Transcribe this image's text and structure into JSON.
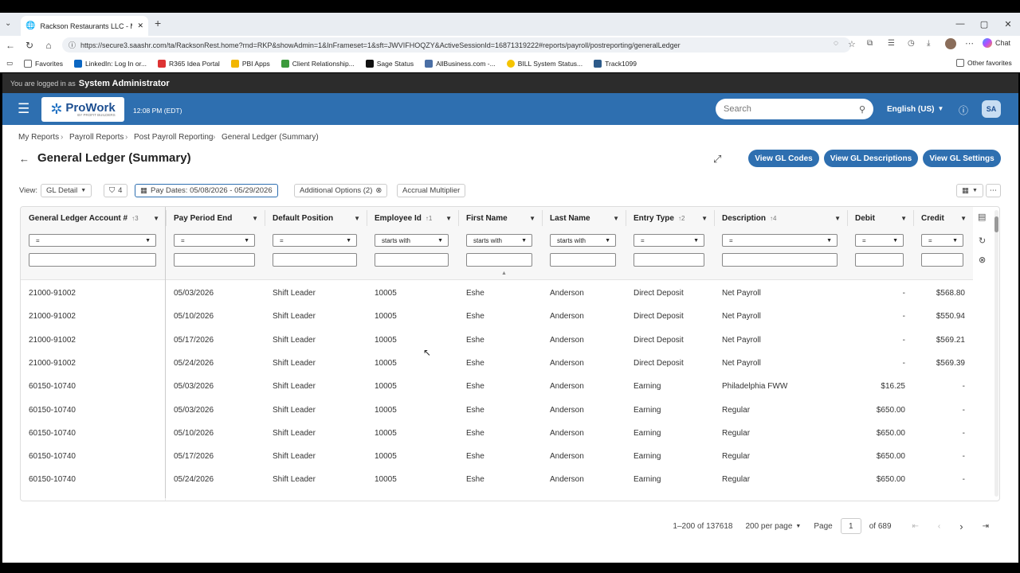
{
  "browser": {
    "tab_title": "Rackson Restaurants LLC - My Rep",
    "url": "https://secure3.saashr.com/ta/RacksonRest.home?rnd=RKP&showAdmin=1&InFrameset=1&sft=JWVIFHOQZY&ActiveSessionId=16871319222#reports/payroll/postreporting/generalLedger",
    "chat_label": "Chat",
    "bookmarks": [
      "Favorites",
      "LinkedIn: Log In or...",
      "R365 Idea Portal",
      "PBI Apps",
      "Client Relationship...",
      "Sage Status",
      "AllBusiness.com -...",
      "BILL System Status...",
      "Track1099"
    ],
    "other_favorites": "Other favorites"
  },
  "app": {
    "logged_in_prefix": "You are logged in as",
    "logged_in_user": "System Administrator",
    "logo_text": "ProWork",
    "logo_sub": "BY PROFIT BUILDERS",
    "time": "12:08 PM (EDT)",
    "search_placeholder": "Search",
    "language": "English (US)",
    "avatar_initials": "SA"
  },
  "breadcrumb": [
    "My Reports",
    "Payroll Reports",
    "Post Payroll Reporting",
    "General Ledger (Summary)"
  ],
  "page_title": "General Ledger (Summary)",
  "buttons": {
    "gl_codes": "View GL Codes",
    "gl_descriptions": "View GL Descriptions",
    "gl_settings": "View GL Settings"
  },
  "toolbar": {
    "view_label": "View:",
    "view_value": "GL Detail",
    "filter_count": "4",
    "pay_dates": "Pay Dates: 05/08/2026 - 05/29/2026",
    "additional_options": "Additional Options (2)",
    "accrual_multiplier": "Accrual Multiplier"
  },
  "columns": [
    {
      "label": "General Ledger Account #",
      "sort": "↑3",
      "filter": "="
    },
    {
      "label": "Pay Period End",
      "sort": "",
      "filter": "="
    },
    {
      "label": "Default Position",
      "sort": "",
      "filter": "="
    },
    {
      "label": "Employee Id",
      "sort": "↑1",
      "filter": "starts with"
    },
    {
      "label": "First Name",
      "sort": "",
      "filter": "starts with"
    },
    {
      "label": "Last Name",
      "sort": "",
      "filter": "starts with"
    },
    {
      "label": "Entry Type",
      "sort": "↑2",
      "filter": "="
    },
    {
      "label": "Description",
      "sort": "↑4",
      "filter": "="
    },
    {
      "label": "Debit",
      "sort": "",
      "filter": "="
    },
    {
      "label": "Credit",
      "sort": "",
      "filter": "="
    }
  ],
  "rows": [
    [
      "21000-91002",
      "05/03/2026",
      "Shift Leader",
      "10005",
      "Eshe",
      "Anderson",
      "Direct Deposit",
      "Net Payroll",
      "-",
      "$568.80"
    ],
    [
      "21000-91002",
      "05/10/2026",
      "Shift Leader",
      "10005",
      "Eshe",
      "Anderson",
      "Direct Deposit",
      "Net Payroll",
      "-",
      "$550.94"
    ],
    [
      "21000-91002",
      "05/17/2026",
      "Shift Leader",
      "10005",
      "Eshe",
      "Anderson",
      "Direct Deposit",
      "Net Payroll",
      "-",
      "$569.21"
    ],
    [
      "21000-91002",
      "05/24/2026",
      "Shift Leader",
      "10005",
      "Eshe",
      "Anderson",
      "Direct Deposit",
      "Net Payroll",
      "-",
      "$569.39"
    ],
    [
      "60150-10740",
      "05/03/2026",
      "Shift Leader",
      "10005",
      "Eshe",
      "Anderson",
      "Earning",
      "Philadelphia FWW",
      "$16.25",
      "-"
    ],
    [
      "60150-10740",
      "05/03/2026",
      "Shift Leader",
      "10005",
      "Eshe",
      "Anderson",
      "Earning",
      "Regular",
      "$650.00",
      "-"
    ],
    [
      "60150-10740",
      "05/10/2026",
      "Shift Leader",
      "10005",
      "Eshe",
      "Anderson",
      "Earning",
      "Regular",
      "$650.00",
      "-"
    ],
    [
      "60150-10740",
      "05/17/2026",
      "Shift Leader",
      "10005",
      "Eshe",
      "Anderson",
      "Earning",
      "Regular",
      "$650.00",
      "-"
    ],
    [
      "60150-10740",
      "05/24/2026",
      "Shift Leader",
      "10005",
      "Eshe",
      "Anderson",
      "Earning",
      "Regular",
      "$650.00",
      "-"
    ]
  ],
  "pager": {
    "range": "1–200 of 137618",
    "per_page": "200 per page",
    "page_label": "Page",
    "page_value": "1",
    "of_pages": "of 689"
  }
}
